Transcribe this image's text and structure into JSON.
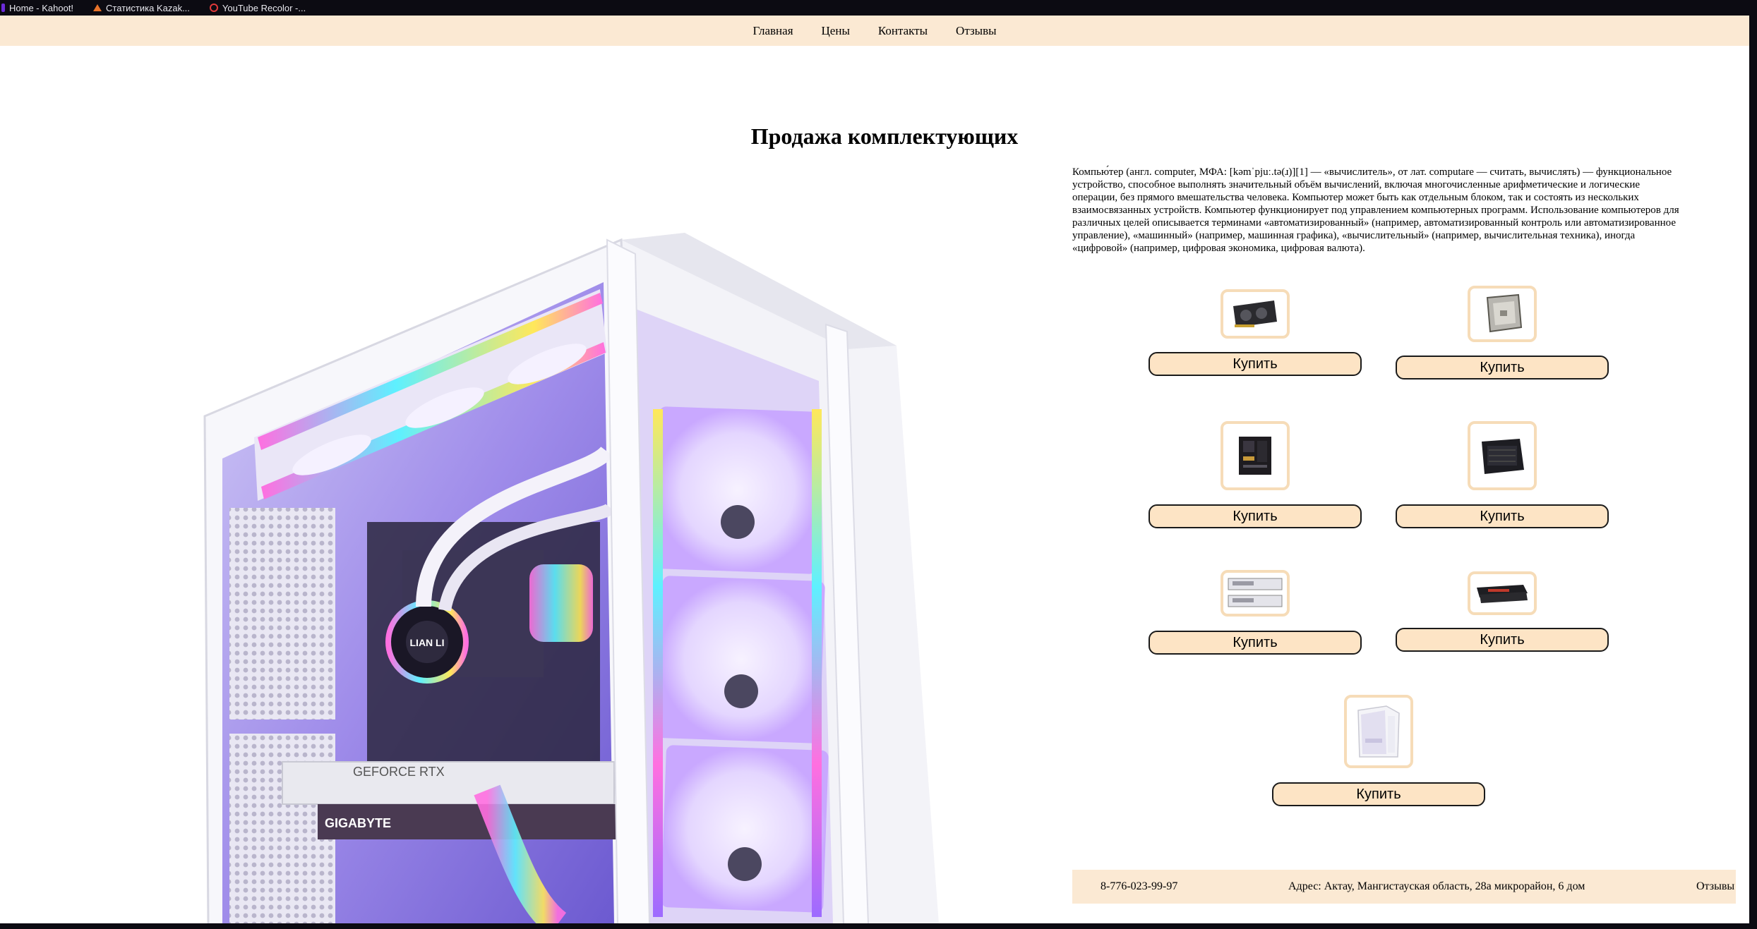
{
  "bookmarks": [
    {
      "label": "Home - Kahoot!",
      "icon": "kahoot-icon"
    },
    {
      "label": "Статистика Kazak...",
      "icon": "chart-icon"
    },
    {
      "label": "YouTube Recolor -...",
      "icon": "youtube-recolor-icon"
    }
  ],
  "nav": {
    "items": [
      "Главная",
      "Цены",
      "Контакты",
      "Отзывы"
    ]
  },
  "page": {
    "title": "Продажа комплектующих",
    "description": "Компью́тер (англ. computer, МФА: [kəmˈpjuː.tə(ɹ)][1] — «вычислитель», от лат. computare — считать, вычислять) — функциональное устройство, способное выполнять значительный объём вычислений, включая многочисленные арифметические и логические операции, без прямого вмешательства человека. Компьютер может быть как отдельным блоком, так и состоять из нескольких взаимосвязанных устройств. Компьютер функционирует под управлением компьютерных программ. Использование компьютеров для различных целей описывается терминами «автоматизированный» (например, автоматизированный контроль или автоматизированное управление), «машинный» (например, машинная графика), «вычислительный» (например, вычислительная техника), иногда «цифровой» (например, цифровая экономика, цифровая валюта).",
    "hero_label": "GIGABYTE",
    "hero_label2": "GEFORCE RTX",
    "hero_brand": "LIAN LI"
  },
  "products": [
    {
      "icon": "graphics-card-icon",
      "buy_label": "Купить"
    },
    {
      "icon": "cpu-icon",
      "buy_label": "Купить"
    },
    {
      "icon": "motherboard-icon",
      "buy_label": "Купить"
    },
    {
      "icon": "power-supply-icon",
      "buy_label": "Купить"
    },
    {
      "icon": "ram-kit-icon",
      "buy_label": "Купить"
    },
    {
      "icon": "ram-stick-icon",
      "buy_label": "Купить"
    },
    {
      "icon": "pc-case-icon",
      "buy_label": "Купить"
    }
  ],
  "footer": {
    "phone": "8-776-023-99-97",
    "address": "Адрес: Актау, Мангистауская область, 28а микрорайон, 6 дом",
    "reviews": "Отзывы"
  },
  "colors": {
    "nav_bg": "#fbe9d3",
    "button_bg": "#fde4c5",
    "thumb_border": "#f6dcb8",
    "chrome_bg": "#0c0b12"
  }
}
